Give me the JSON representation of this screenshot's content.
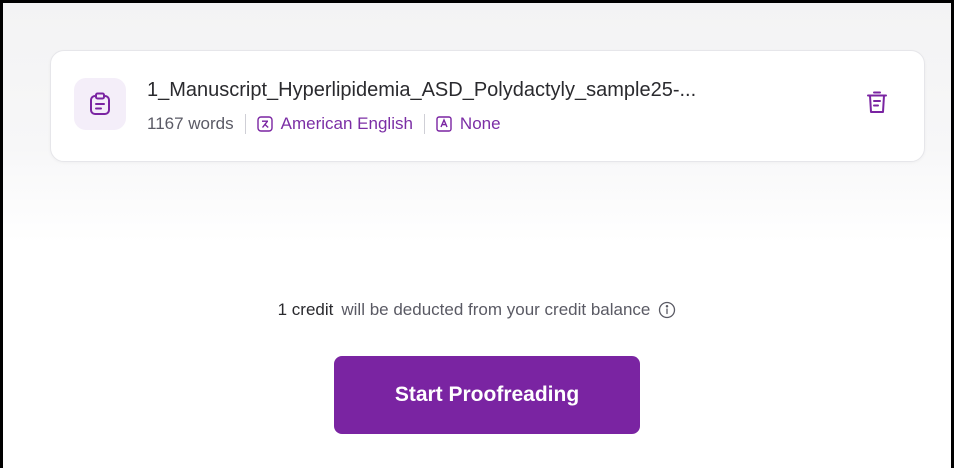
{
  "file": {
    "name": "1_Manuscript_Hyperlipidemia_ASD_Polydactyly_sample25-...",
    "word_count": "1167 words",
    "language": "American English",
    "style": "None",
    "icon": "clipboard-document-icon",
    "delete_icon": "trash-icon"
  },
  "credit_notice": {
    "amount": "1 credit",
    "message": "will be deducted from your credit balance",
    "icon": "info-icon"
  },
  "actions": {
    "start_label": "Start Proofreading"
  },
  "colors": {
    "accent": "#7a24a2",
    "accent_light": "#f4eef9"
  }
}
